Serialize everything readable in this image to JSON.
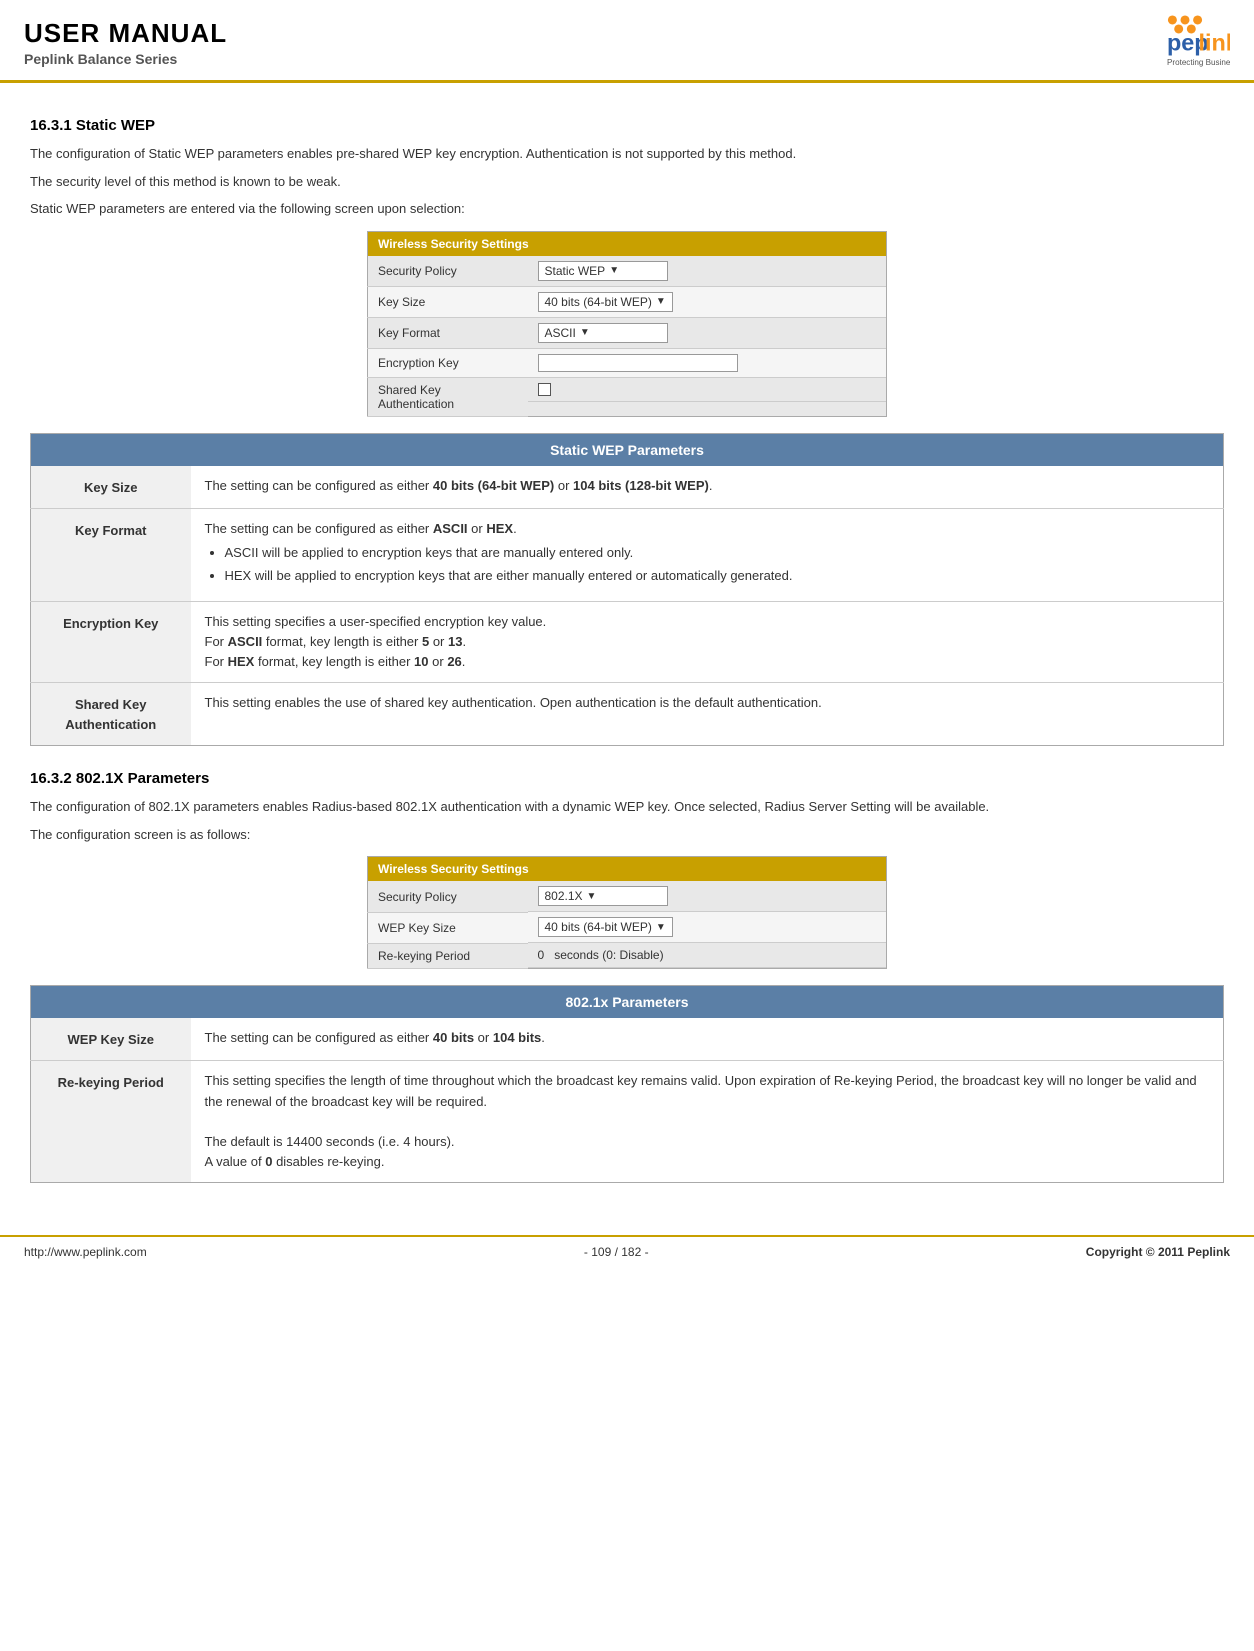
{
  "header": {
    "title": "USER MANUAL",
    "subtitle": "Peplink Balance Series",
    "logo_text": "peplink",
    "logo_tagline": "Protecting Business Continuity"
  },
  "section1": {
    "heading": "16.3.1 Static WEP",
    "para1": "The configuration of Static WEP parameters enables pre-shared WEP key encryption.  Authentication is not supported by this method.",
    "para2": "The security level of this method is known to be weak.",
    "para3": "Static WEP parameters are entered via the following screen upon selection:"
  },
  "wss1": {
    "title": "Wireless Security Settings",
    "rows": [
      {
        "label": "Security Policy",
        "value": "Static WEP",
        "type": "dropdown"
      },
      {
        "label": "Key Size",
        "value": "40 bits (64-bit WEP)",
        "type": "dropdown"
      },
      {
        "label": "Key Format",
        "value": "ASCII",
        "type": "dropdown"
      },
      {
        "label": "Encryption Key",
        "value": "",
        "type": "input"
      },
      {
        "label": "Shared Key Authentication",
        "value": "",
        "type": "checkbox"
      }
    ]
  },
  "params1": {
    "heading": "Static WEP Parameters",
    "rows": [
      {
        "label": "Key Size",
        "content": "The setting can be configured as either 40 bits (64-bit WEP) or 104 bits (128-bit WEP).",
        "bold_parts": [
          "40 bits (64-bit WEP)",
          "104 bits (128-bit WEP)"
        ]
      },
      {
        "label": "Key Format",
        "content": "The setting can be configured as either ASCII or HEX.",
        "bullets": [
          "ASCII will be applied to encryption keys that are manually entered only.",
          "HEX will be applied to encryption keys that are either manually entered or automatically generated."
        ],
        "bold_parts": [
          "ASCII",
          "HEX"
        ]
      },
      {
        "label": "Encryption Key",
        "content": "This setting specifies a user-specified encryption key value.",
        "extra": [
          "For ASCII format, key length is either 5 or 13.",
          "For HEX format, key length is either 10 or 26."
        ],
        "bold_parts": [
          "ASCII",
          "5",
          "13",
          "HEX",
          "10",
          "26"
        ]
      },
      {
        "label": "Shared Key Authentication",
        "content": "This setting enables the use of shared key authentication.  Open authentication is the default authentication."
      }
    ]
  },
  "section2": {
    "heading": "16.3.2 802.1X Parameters",
    "para1": "The configuration of 802.1X parameters enables Radius-based 802.1X authentication with a dynamic WEP key.  Once selected, Radius Server Setting will be available.",
    "para2": "The configuration screen is as follows:"
  },
  "wss2": {
    "title": "Wireless Security Settings",
    "rows": [
      {
        "label": "Security Policy",
        "value": "802.1X",
        "type": "dropdown"
      },
      {
        "label": "WEP Key Size",
        "value": "40 bits (64-bit WEP)",
        "type": "dropdown"
      },
      {
        "label": "Re-keying Period",
        "value": "0",
        "unit": "seconds (0: Disable)",
        "type": "input-unit"
      }
    ]
  },
  "params2": {
    "heading": "802.1x Parameters",
    "rows": [
      {
        "label": "WEP Key Size",
        "content": "The setting can be configured as either 40 bits or 104 bits.",
        "bold_parts": [
          "40 bits",
          "104 bits"
        ]
      },
      {
        "label": "Re-keying Period",
        "content": "This setting specifies the length of time throughout which the broadcast key remains valid. Upon expiration of Re-keying Period, the broadcast key will no longer be valid and the renewal of the broadcast key will be required.",
        "extra": [
          "The default is 14400 seconds (i.e. 4 hours).",
          "A value of 0 disables re-keying."
        ],
        "bold_zero": true
      }
    ]
  },
  "footer": {
    "url": "http://www.peplink.com",
    "page": "- 109 / 182 -",
    "copyright": "Copyright © 2011 Peplink"
  }
}
